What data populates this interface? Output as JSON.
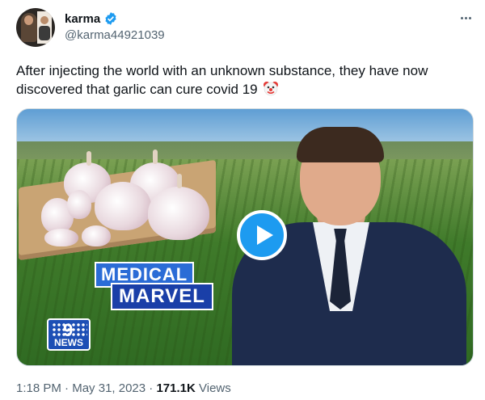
{
  "user": {
    "display_name": "karma",
    "handle": "@karma44921039",
    "verified_icon": "verified-badge-icon"
  },
  "tweet": {
    "text": "After injecting the world with an unknown substance, they have now discovered that garlic can cure covid 19",
    "emoji": "clown-face-icon"
  },
  "media": {
    "label_line1": "MEDICAL",
    "label_line2": "MARVEL",
    "logo_number": "9",
    "logo_text": "NEWS",
    "play_icon": "play-icon"
  },
  "meta": {
    "time": "1:18 PM",
    "separator1": " · ",
    "date": "May 31, 2023",
    "separator2": " · ",
    "views_count": "171.1K",
    "views_label": " Views"
  },
  "colors": {
    "accent": "#1d9bf0",
    "text": "#0f1419",
    "secondary": "#536471"
  }
}
